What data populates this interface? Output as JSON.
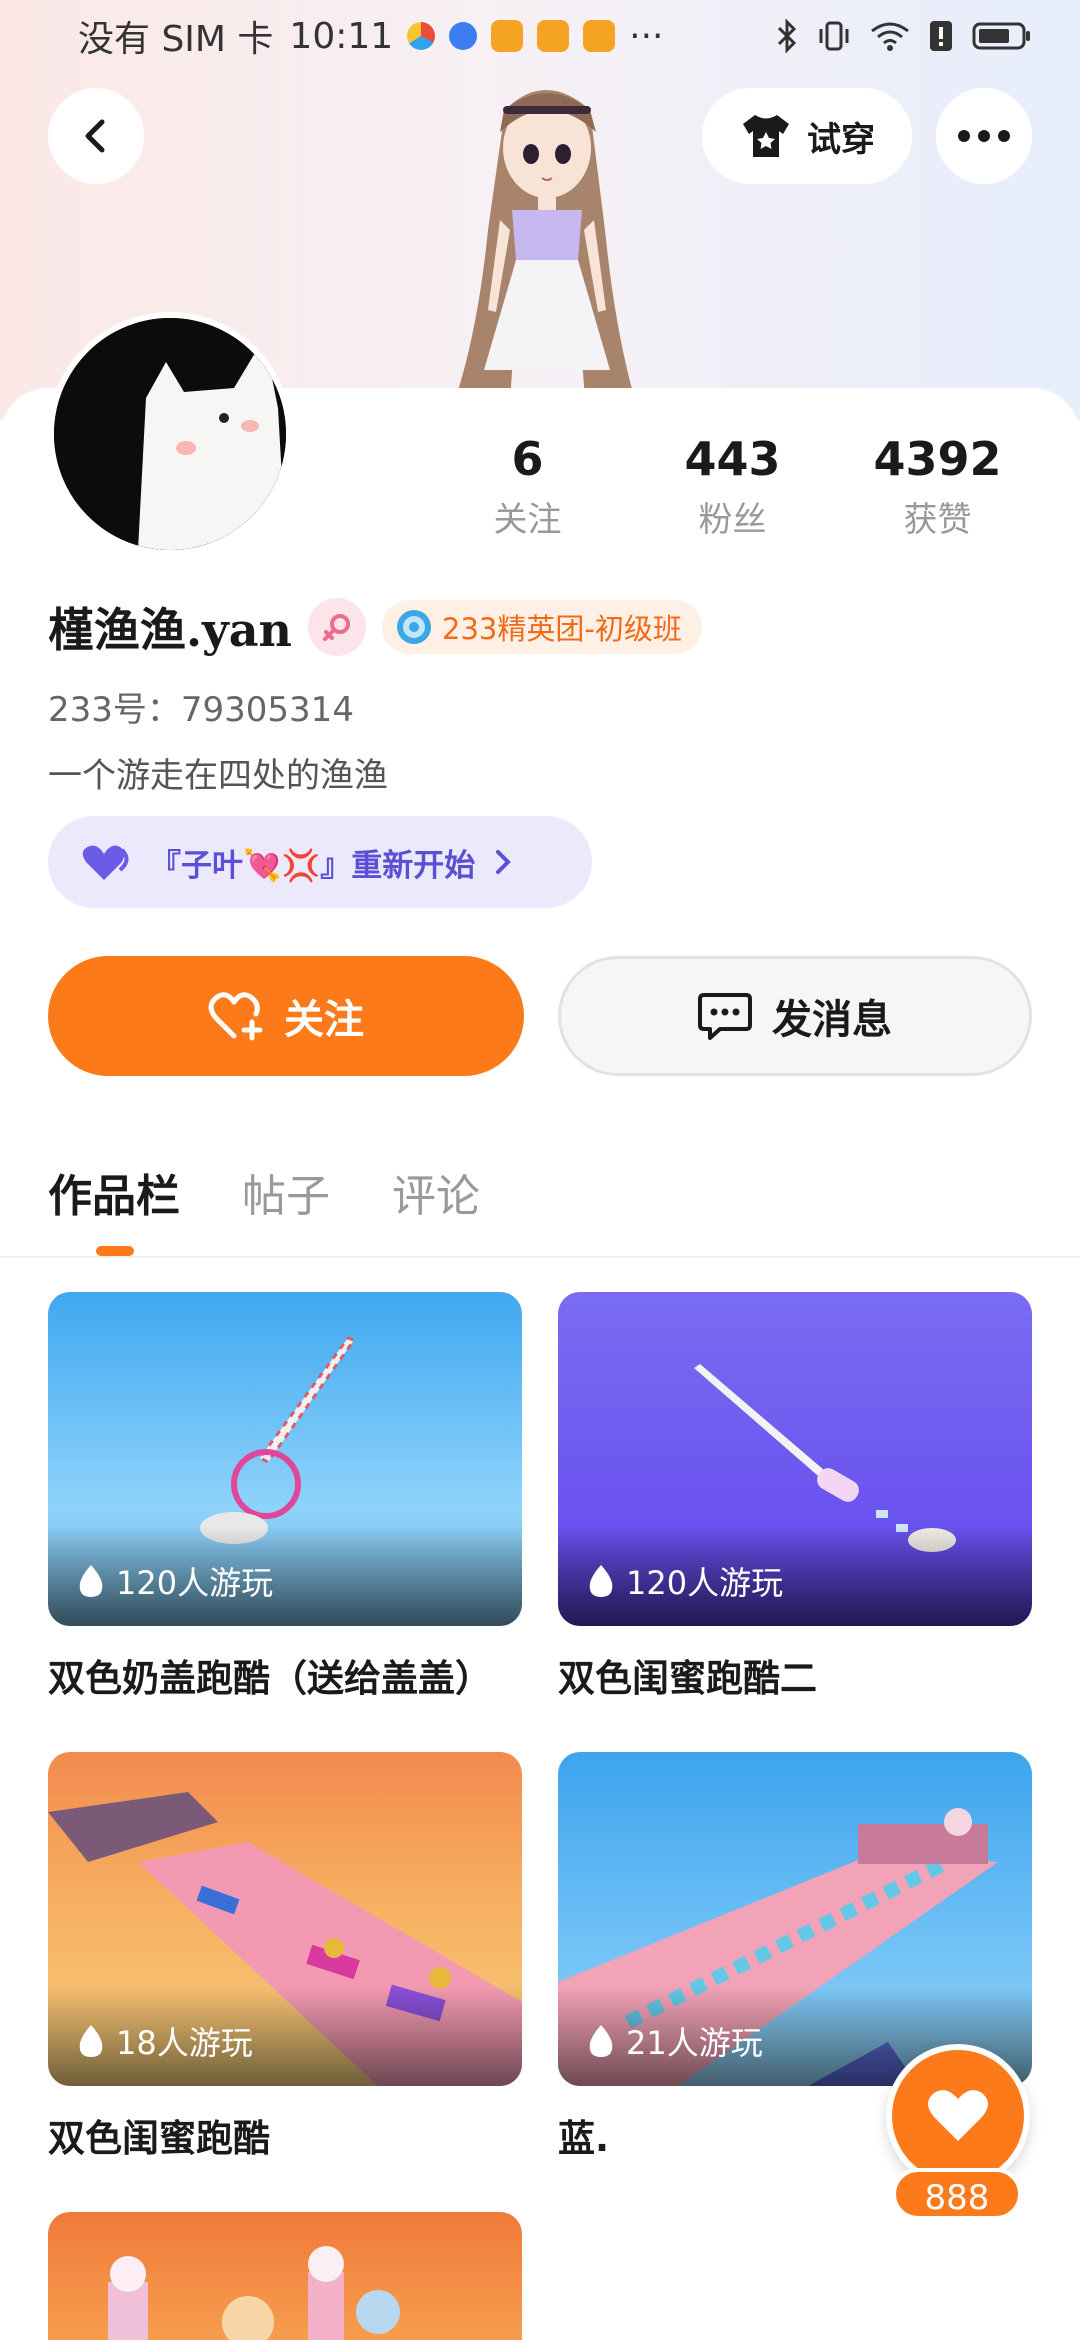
{
  "status_bar": {
    "carrier": "没有 SIM 卡",
    "time": "10:11",
    "more": "···"
  },
  "header": {
    "back_label": "back",
    "tryon_label": "试穿"
  },
  "profile": {
    "stats": [
      {
        "value": "6",
        "label": "关注"
      },
      {
        "value": "443",
        "label": "粉丝"
      },
      {
        "value": "4392",
        "label": "获赞"
      }
    ],
    "username": "槿渔渔.yan",
    "rank_badge": "233精英团-初级班",
    "uid": "233号：79305314",
    "bio": "一个游走在四处的渔渔",
    "group_chip": "『子叶💘💢』重新开始"
  },
  "actions": {
    "follow_label": "关注",
    "message_label": "发消息"
  },
  "tabs": [
    {
      "label": "作品栏",
      "active": true
    },
    {
      "label": "帖子",
      "active": false
    },
    {
      "label": "评论",
      "active": false
    }
  ],
  "games": [
    {
      "title": "双色奶盖跑酷（送给盖盖）",
      "plays": "120人游玩"
    },
    {
      "title": "双色闺蜜跑酷二",
      "plays": "120人游玩"
    },
    {
      "title": "双色闺蜜跑酷",
      "plays": "18人游玩"
    },
    {
      "title": "蓝.",
      "plays": "21人游玩"
    }
  ],
  "like_fab": {
    "count": "888"
  },
  "colors": {
    "accent": "#fd7a1b",
    "chip_bg": "#ebe9fb",
    "chip_text": "#5b4fd6"
  }
}
